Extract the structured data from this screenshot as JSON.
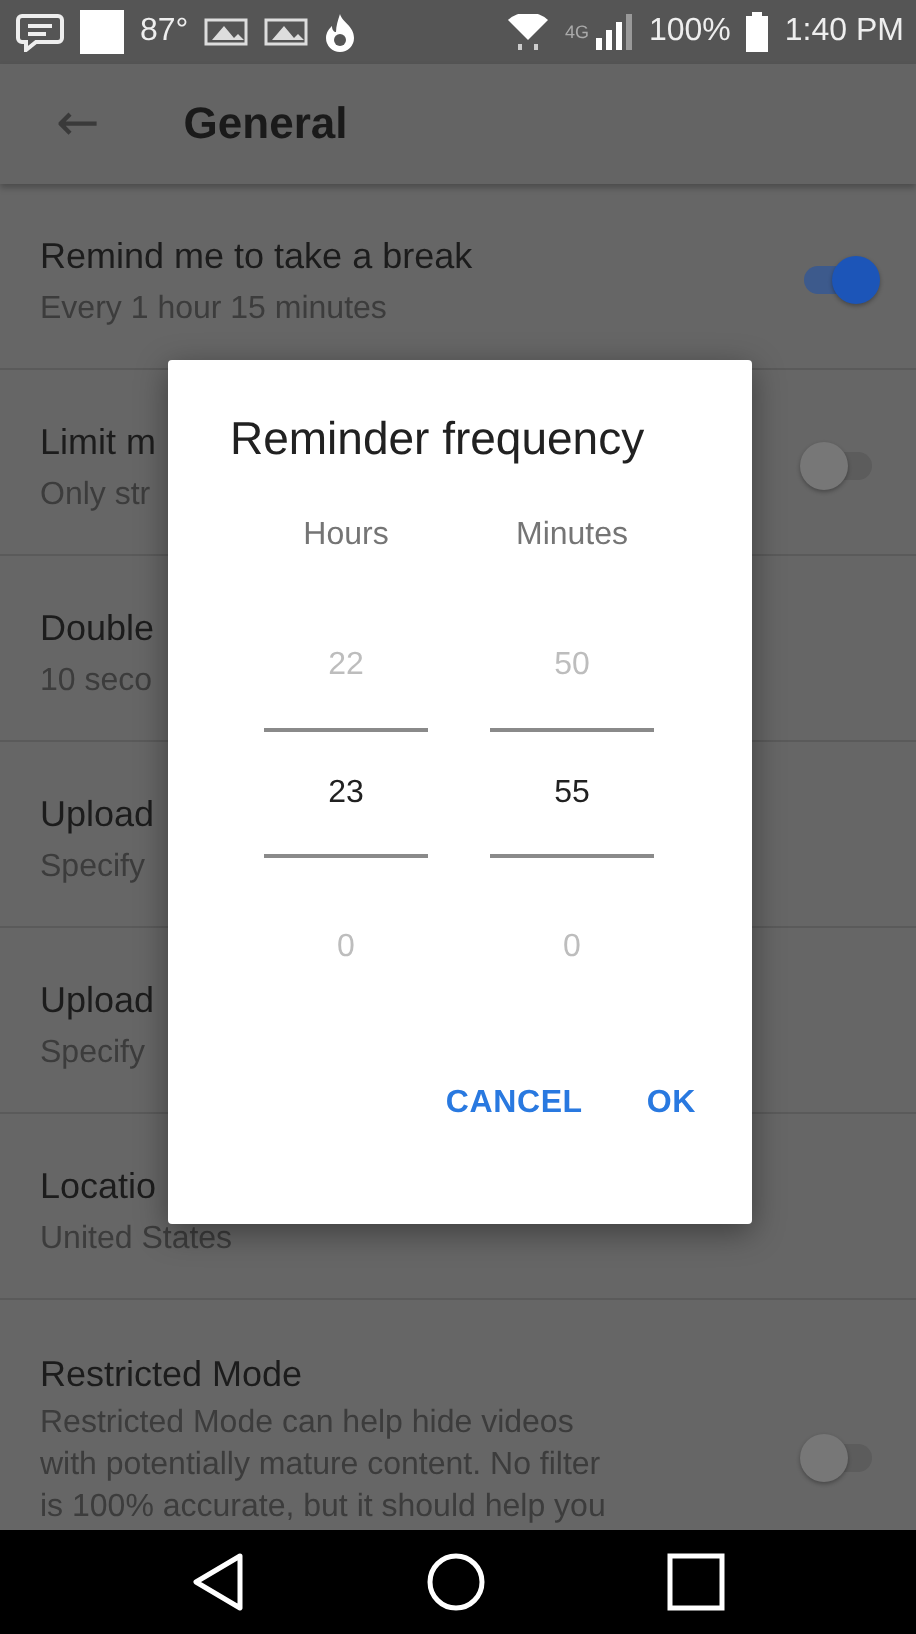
{
  "status_bar": {
    "left_texts": [
      "87°"
    ],
    "network": "4G",
    "battery": "100%",
    "time": "1:40 PM"
  },
  "app_bar": {
    "back": "←",
    "title": "General"
  },
  "settings": [
    {
      "kind": "toggle",
      "title": "Remind me to take a break",
      "subtitle": "Every 1 hour 15 minutes",
      "on": true
    },
    {
      "kind": "toggle",
      "title": "Limit m",
      "subtitle": "Only str",
      "on": false
    },
    {
      "kind": "plain",
      "title": "Double",
      "subtitle": "10 seco"
    },
    {
      "kind": "plain",
      "title": "Upload",
      "subtitle": "Specify"
    },
    {
      "kind": "plain",
      "title": "Upload",
      "subtitle": "Specify"
    },
    {
      "kind": "plain",
      "title": "Locatio",
      "subtitle": "United States"
    },
    {
      "kind": "toggle",
      "title": "Restricted Mode",
      "subtitle": "Restricted Mode can help hide videos with potentially mature content. No filter is 100% accurate, but it should help you",
      "on": false
    }
  ],
  "dialog": {
    "title": "Reminder frequency",
    "columns": [
      {
        "label": "Hours",
        "previous": "22",
        "current": "23",
        "next": "0"
      },
      {
        "label": "Minutes",
        "previous": "50",
        "current": "55",
        "next": "0"
      }
    ],
    "buttons": [
      "CANCEL",
      "OK"
    ]
  }
}
